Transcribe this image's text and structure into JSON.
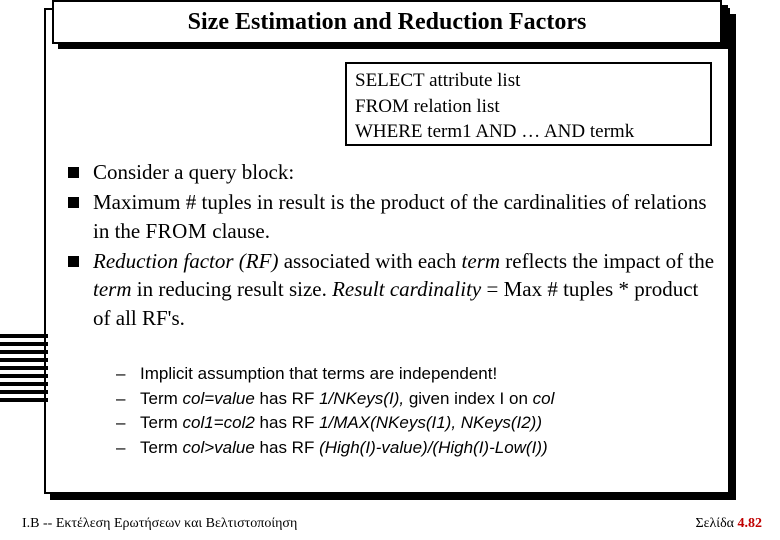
{
  "title": "Size Estimation and Reduction Factors",
  "sql": {
    "line1_kw": "SELECT",
    "line1_rest": " attribute list",
    "line2_kw": "FROM",
    "line2_rest": " relation list",
    "line3_kw": "WHERE",
    "line3_rest_a": " term",
    "line3_rest_b": "1 ",
    "line3_and1": "AND",
    "line3_mid": " … ",
    "line3_and2": "AND",
    "line3_rest_c": " term",
    "line3_rest_d": "k"
  },
  "bullets": {
    "b1": "Consider a query block:",
    "b2_a": "Maximum # tuples in result is the product of the cardinalities of relations in the ",
    "b2_from": "FROM",
    "b2_b": " clause.",
    "b3_a": "Reduction factor (RF)",
    "b3_b": " associated with each ",
    "b3_c": "term",
    "b3_d": " reflects the impact of the ",
    "b3_e": "term",
    "b3_f": " in reducing result size.  ",
    "b3_g": "Result cardinality",
    "b3_h": " = Max # tuples  *  product of all RF's."
  },
  "subs": {
    "s1": "Implicit assumption that terms are independent!",
    "s2_a": "Term ",
    "s2_b": "col=value",
    "s2_c": " has RF ",
    "s2_d": "1/NKeys(I),",
    "s2_e": " given index I on ",
    "s2_f": "col",
    "s3_a": "Term ",
    "s3_b": "col1=col2",
    "s3_c": " has RF ",
    "s3_d": "1/",
    "s3_max": "MAX",
    "s3_e": "(NKeys(I1), NKeys(I2))",
    "s4_a": "Term ",
    "s4_b": "col>value",
    "s4_c": " has RF ",
    "s4_d": "(High(I)-value)/(High(I)-Low(I))"
  },
  "footer": {
    "left": "Ι.Β -- Εκτέλεση Ερωτήσεων και Βελτιστοποίηση",
    "right_label": "Σελίδα ",
    "right_page": "4.82"
  }
}
